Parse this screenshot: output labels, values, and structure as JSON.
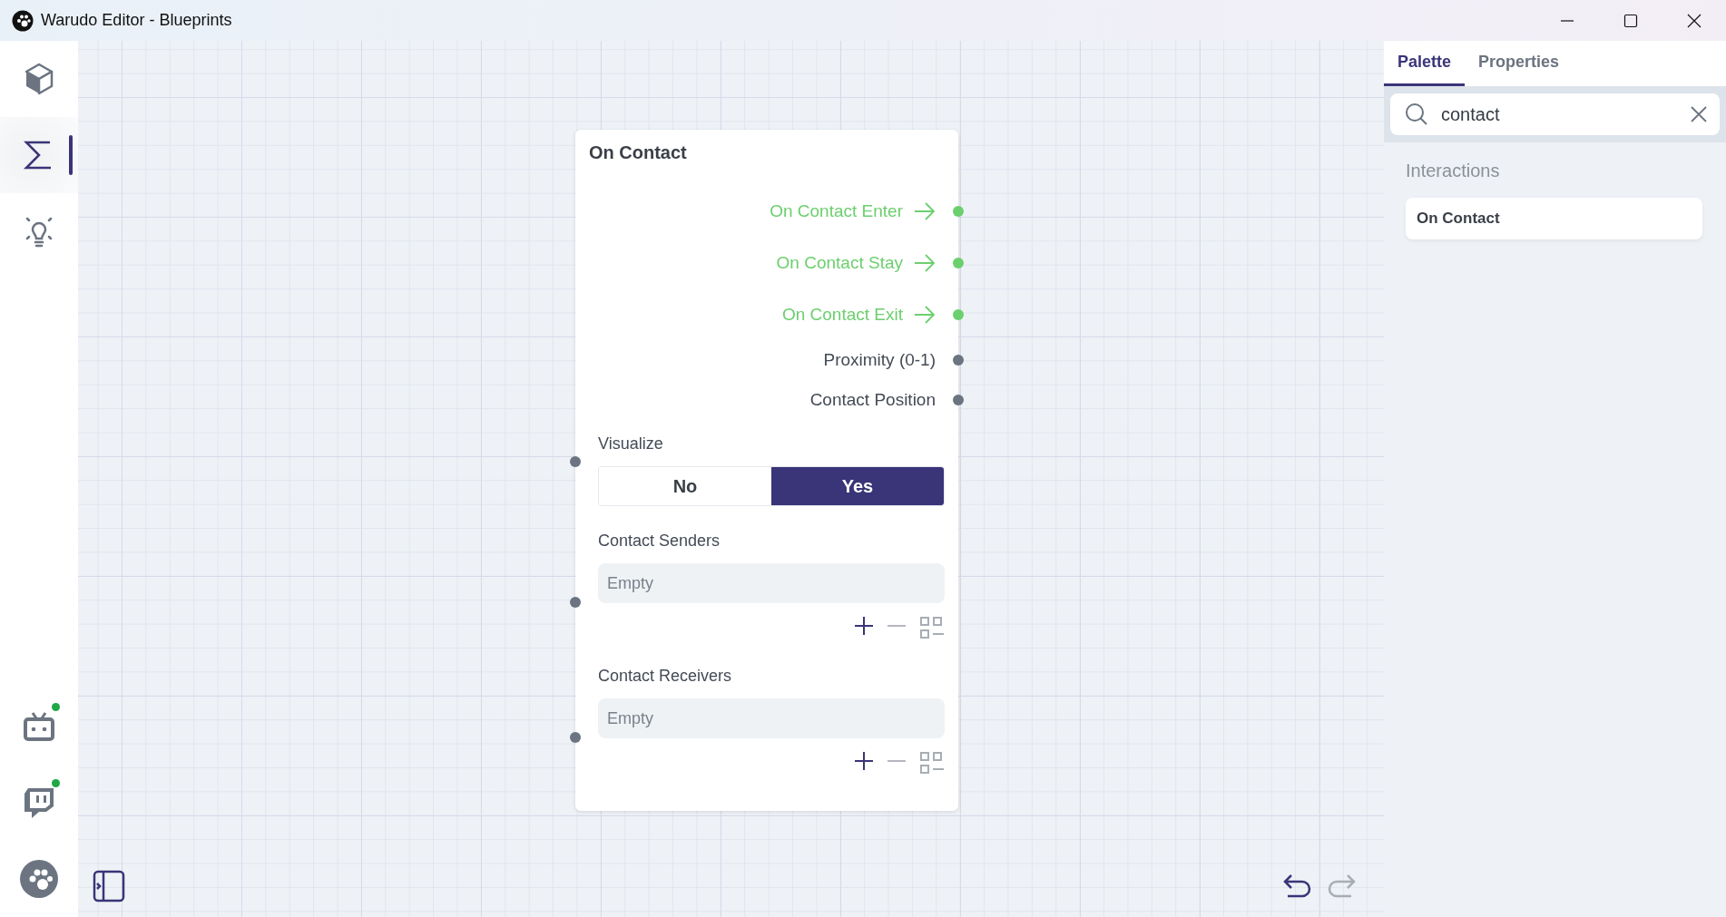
{
  "window": {
    "title": "Warudo Editor - Blueprints"
  },
  "sidebar": {
    "top_items": [
      {
        "selected": false
      },
      {
        "selected": true
      },
      {
        "selected": false
      }
    ],
    "bottom_items": [
      {
        "online": true
      },
      {
        "online": true
      },
      {
        "online": false
      }
    ]
  },
  "node": {
    "title": "On Contact",
    "outputs": [
      {
        "label": "On Contact Enter",
        "kind": "flow"
      },
      {
        "label": "On Contact Stay",
        "kind": "flow"
      },
      {
        "label": "On Contact Exit",
        "kind": "flow"
      },
      {
        "label": "Proximity (0-1)",
        "kind": "data"
      },
      {
        "label": "Contact Position",
        "kind": "data"
      }
    ],
    "visualize": {
      "label": "Visualize",
      "options": [
        {
          "label": "No",
          "selected": false
        },
        {
          "label": "Yes",
          "selected": true
        }
      ]
    },
    "lists": [
      {
        "label": "Contact Senders",
        "placeholder": "Empty",
        "can_remove": false
      },
      {
        "label": "Contact Receivers",
        "placeholder": "Empty",
        "can_remove": false
      }
    ]
  },
  "history": {
    "can_undo": true,
    "can_redo": false
  },
  "panel": {
    "tabs": [
      {
        "label": "Palette",
        "selected": true
      },
      {
        "label": "Properties",
        "selected": false
      }
    ],
    "search": {
      "value": "contact"
    },
    "groups": [
      {
        "title": "Interactions",
        "items": [
          "On Contact"
        ]
      }
    ]
  }
}
